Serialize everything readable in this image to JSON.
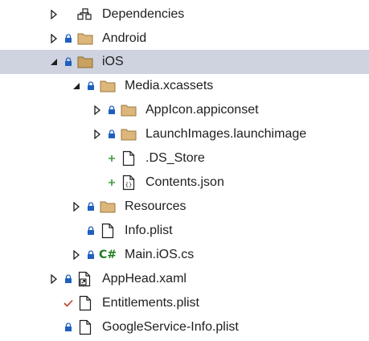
{
  "tree": {
    "items": [
      {
        "label": "Dependencies",
        "icon": "dependencies-icon",
        "expander": "collapsed",
        "status": "none"
      },
      {
        "label": "Android",
        "icon": "folder-icon",
        "expander": "collapsed",
        "status": "lock"
      },
      {
        "label": "iOS",
        "icon": "folder-icon",
        "expander": "expanded",
        "status": "lock",
        "selected": true
      },
      {
        "label": "Media.xcassets",
        "icon": "folder-icon",
        "expander": "expanded",
        "status": "lock"
      },
      {
        "label": "AppIcon.appiconset",
        "icon": "folder-icon",
        "expander": "collapsed",
        "status": "lock"
      },
      {
        "label": "LaunchImages.launchimage",
        "icon": "folder-icon",
        "expander": "collapsed",
        "status": "lock"
      },
      {
        "label": ".DS_Store",
        "icon": "file-icon",
        "expander": "none",
        "status": "added"
      },
      {
        "label": "Contents.json",
        "icon": "json-file-icon",
        "expander": "none",
        "status": "added"
      },
      {
        "label": "Resources",
        "icon": "folder-icon",
        "expander": "collapsed",
        "status": "lock"
      },
      {
        "label": "Info.plist",
        "icon": "file-icon",
        "expander": "none",
        "status": "lock"
      },
      {
        "label": "Main.iOS.cs",
        "icon": "csharp-file-icon",
        "icon_text": "C#",
        "expander": "collapsed",
        "status": "lock"
      },
      {
        "label": "AppHead.xaml",
        "icon": "xaml-file-icon",
        "expander": "collapsed",
        "status": "lock"
      },
      {
        "label": "Entitlements.plist",
        "icon": "file-icon",
        "expander": "none",
        "status": "modified"
      },
      {
        "label": "GoogleService-Info.plist",
        "icon": "file-icon",
        "expander": "none",
        "status": "lock"
      }
    ]
  },
  "colors": {
    "selection": "#cfd3e0",
    "folder_fill": "#dcb67a",
    "folder_stroke": "#9c7a3c",
    "lock": "#1f5fbf",
    "added": "#3c9a3c",
    "modified": "#c0392b",
    "csharp": "#1f7a1f"
  }
}
